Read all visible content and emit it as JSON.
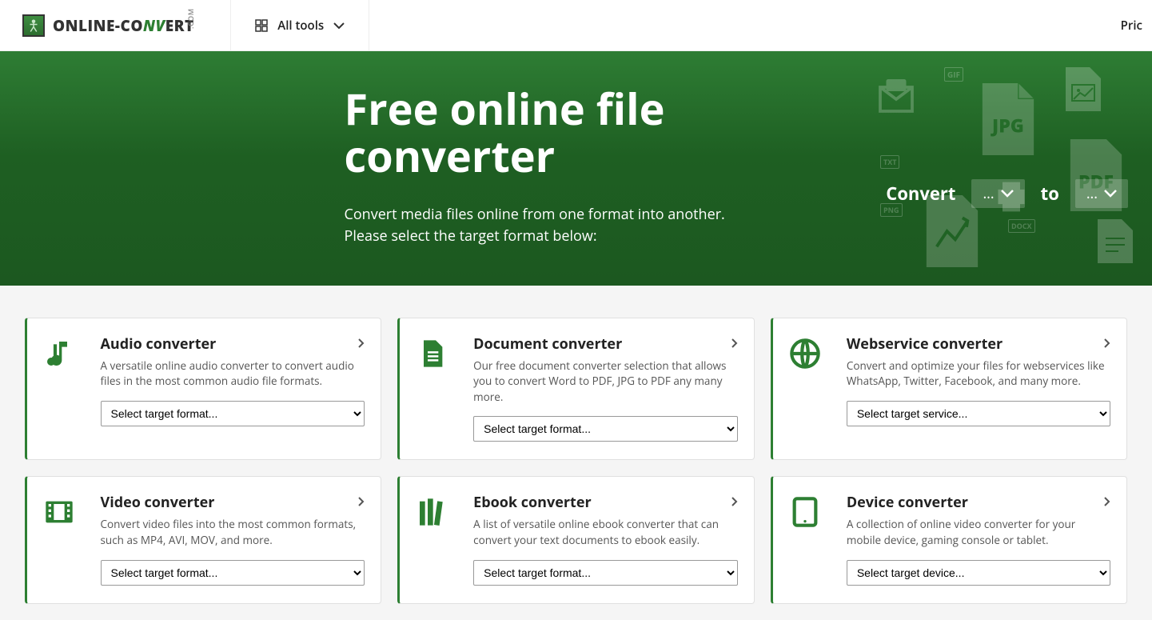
{
  "header": {
    "logo_part1": "ONLINE-",
    "logo_part2": "CO",
    "logo_nv": "NV",
    "logo_part3": "ERT",
    "logo_dotcom": ".COM",
    "all_tools": "All tools",
    "pricing": "Pric"
  },
  "hero": {
    "title": "Free online file converter",
    "subtitle": "Convert media files online from one format into another. Please select the target format below:",
    "convert_label": "Convert",
    "from_placeholder": "...",
    "to_label": "to",
    "to_placeholder": "..."
  },
  "cards": [
    {
      "title": "Audio converter",
      "desc": "A versatile online audio converter to convert audio files in the most common audio file formats.",
      "select": "Select target format..."
    },
    {
      "title": "Document converter",
      "desc": "Our free document converter selection that allows you to convert Word to PDF, JPG to PDF any many more.",
      "select": "Select target format..."
    },
    {
      "title": "Webservice converter",
      "desc": "Convert and optimize your files for webservices like WhatsApp, Twitter, Facebook, and many more.",
      "select": "Select target service..."
    },
    {
      "title": "Video converter",
      "desc": "Convert video files into the most common formats, such as MP4, AVI, MOV, and more.",
      "select": "Select target format..."
    },
    {
      "title": "Ebook converter",
      "desc": "A list of versatile online ebook converter that can convert your text documents to ebook easily.",
      "select": "Select target format..."
    },
    {
      "title": "Device converter",
      "desc": "A collection of online video converter for your mobile device, gaming console or tablet.",
      "select": "Select target device..."
    }
  ]
}
